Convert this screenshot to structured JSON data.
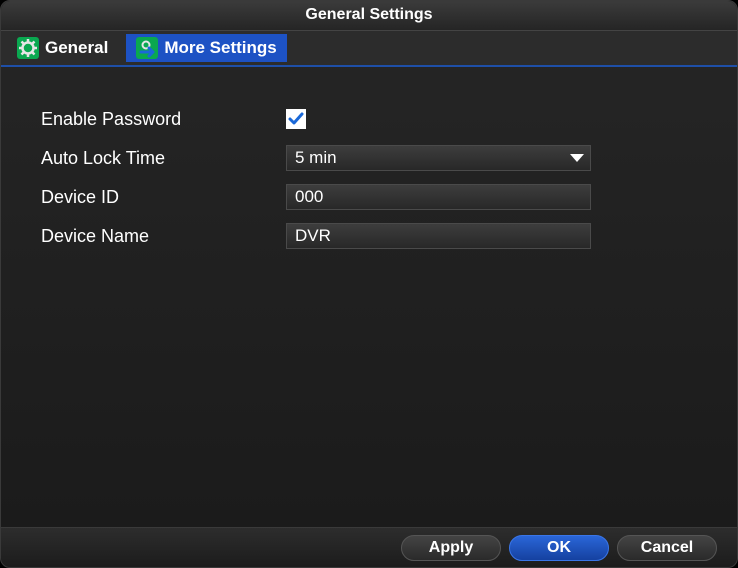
{
  "title": "General Settings",
  "tabs": {
    "general": "General",
    "more": "More Settings"
  },
  "fields": {
    "enablePassword": {
      "label": "Enable Password",
      "checked": true
    },
    "autoLock": {
      "label": "Auto Lock Time",
      "value": "5 min"
    },
    "deviceId": {
      "label": "Device ID",
      "value": "000"
    },
    "deviceName": {
      "label": "Device Name",
      "value": "DVR"
    }
  },
  "buttons": {
    "apply": "Apply",
    "ok": "OK",
    "cancel": "Cancel"
  }
}
